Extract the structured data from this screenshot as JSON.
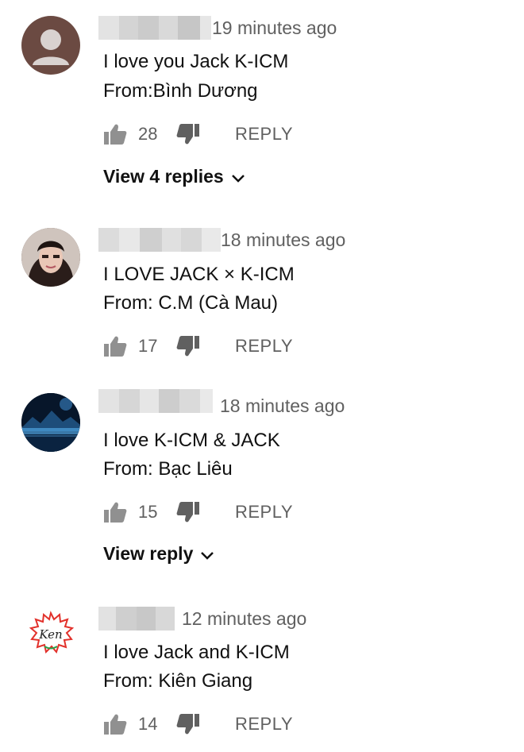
{
  "comments": [
    {
      "time": "19 minutes ago",
      "line1": "I love you Jack K-ICM",
      "line2": "From:Bình Dương",
      "likes": "28",
      "reply_label": "REPLY",
      "view_replies": "View 4 replies"
    },
    {
      "time": "18 minutes ago",
      "line1": "I LOVE JACK × K-ICM",
      "line2": "From: C.M (Cà Mau)",
      "likes": "17",
      "reply_label": "REPLY"
    },
    {
      "time": "18 minutes ago",
      "line1": "I love K-ICM & JACK",
      "line2": "From: Bạc Liêu",
      "likes": "15",
      "reply_label": "REPLY",
      "view_replies": "View reply"
    },
    {
      "time": "12 minutes ago",
      "line1": "I love Jack and K-ICM",
      "line2": "From: Kiên Giang",
      "likes": "14",
      "reply_label": "REPLY",
      "avatar_text": "Ken"
    }
  ]
}
